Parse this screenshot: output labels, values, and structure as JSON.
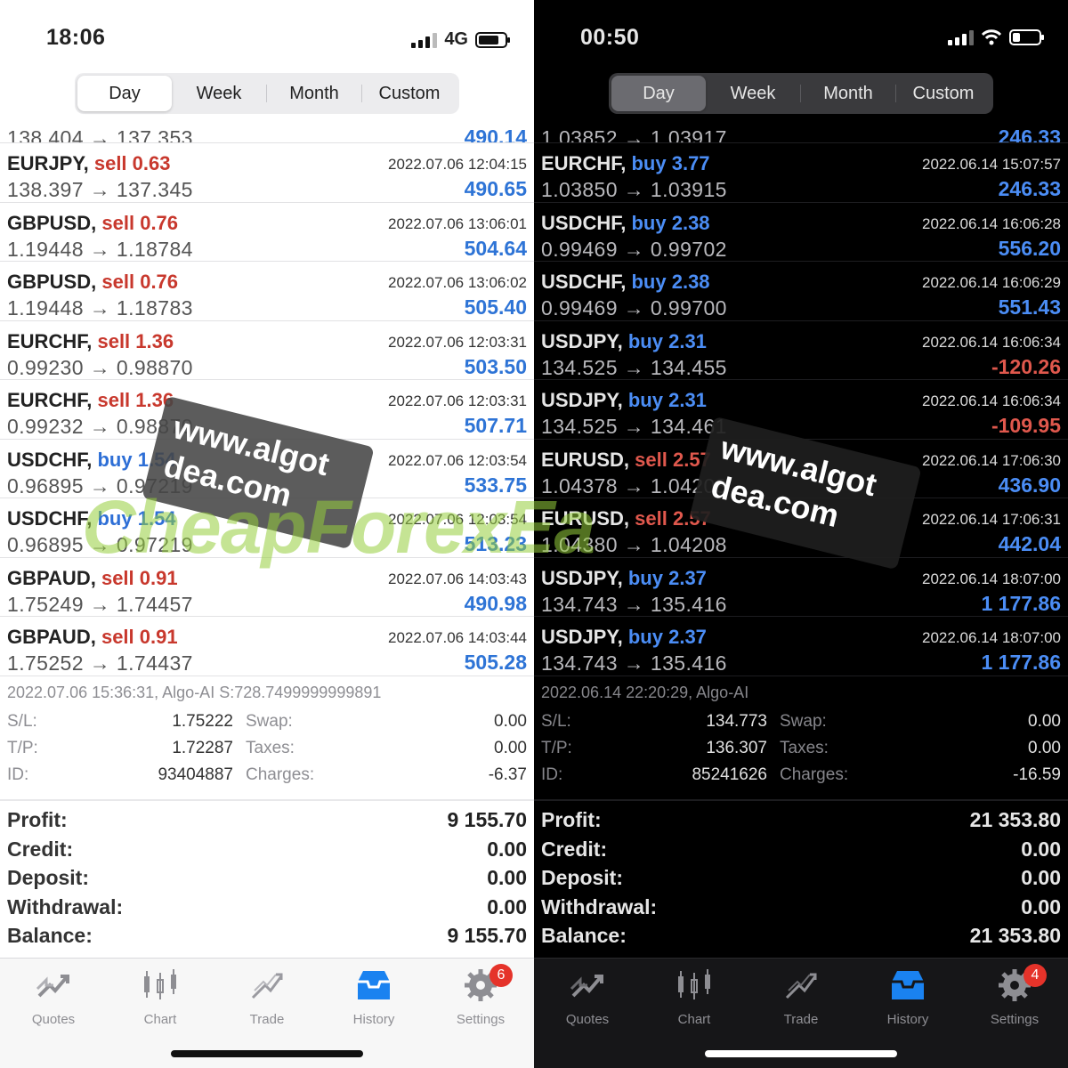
{
  "left": {
    "status": {
      "time": "18:06",
      "network": "4G"
    },
    "tabs": [
      "Day",
      "Week",
      "Month",
      "Custom"
    ],
    "active_tab": "Day",
    "partial_row": {
      "prices": "138.404 → 137.353",
      "pl": "490.14"
    },
    "deals": [
      {
        "symbol": "EURJPY,",
        "side": "sell",
        "volume": "0.63",
        "datetime": "2022.07.06 12:04:15",
        "prices": "138.397 → 137.345",
        "pl": "490.65",
        "neg": false
      },
      {
        "symbol": "GBPUSD,",
        "side": "sell",
        "volume": "0.76",
        "datetime": "2022.07.06 13:06:01",
        "prices": "1.19448 → 1.18784",
        "pl": "504.64",
        "neg": false
      },
      {
        "symbol": "GBPUSD,",
        "side": "sell",
        "volume": "0.76",
        "datetime": "2022.07.06 13:06:02",
        "prices": "1.19448 → 1.18783",
        "pl": "505.40",
        "neg": false
      },
      {
        "symbol": "EURCHF,",
        "side": "sell",
        "volume": "1.36",
        "datetime": "2022.07.06 12:03:31",
        "prices": "0.99230 → 0.98870",
        "pl": "503.50",
        "neg": false
      },
      {
        "symbol": "EURCHF,",
        "side": "sell",
        "volume": "1.36",
        "datetime": "2022.07.06 12:03:31",
        "prices": "0.99232 → 0.98870",
        "pl": "507.71",
        "neg": false
      },
      {
        "symbol": "USDCHF,",
        "side": "buy",
        "volume": "1.54",
        "datetime": "2022.07.06 12:03:54",
        "prices": "0.96895 → 0.97219",
        "pl": "533.75",
        "neg": false
      },
      {
        "symbol": "USDCHF,",
        "side": "buy",
        "volume": "1.54",
        "datetime": "2022.07.06 12:03:54",
        "prices": "0.96895 → 0.97219",
        "pl": "513.23",
        "neg": false
      },
      {
        "symbol": "GBPAUD,",
        "side": "sell",
        "volume": "0.91",
        "datetime": "2022.07.06 14:03:43",
        "prices": "1.75249 → 1.74457",
        "pl": "490.98",
        "neg": false
      },
      {
        "symbol": "GBPAUD,",
        "side": "sell",
        "volume": "0.91",
        "datetime": "2022.07.06 14:03:44",
        "prices": "1.75252 → 1.74437",
        "pl": "505.28",
        "neg": false
      }
    ],
    "detail": {
      "title": "2022.07.06 15:36:31, Algo-AI S:728.7499999999891",
      "sl_label": "S/L:",
      "sl": "1.75222",
      "swap_label": "Swap:",
      "swap": "0.00",
      "tp_label": "T/P:",
      "tp": "1.72287",
      "taxes_label": "Taxes:",
      "taxes": "0.00",
      "id_label": "ID:",
      "id": "93404887",
      "charges_label": "Charges:",
      "charges": "-6.37"
    },
    "summary": {
      "profit_label": "Profit:",
      "profit": "9 155.70",
      "credit_label": "Credit:",
      "credit": "0.00",
      "deposit_label": "Deposit:",
      "deposit": "0.00",
      "withdrawal_label": "Withdrawal:",
      "withdrawal": "0.00",
      "balance_label": "Balance:",
      "balance": "9 155.70"
    },
    "tabbar": [
      "Quotes",
      "Chart",
      "Trade",
      "History",
      "Settings"
    ],
    "settings_badge": "6"
  },
  "right": {
    "status": {
      "time": "00:50"
    },
    "tabs": [
      "Day",
      "Week",
      "Month",
      "Custom"
    ],
    "active_tab": "Day",
    "partial_row": {
      "prices": "1.03852 → 1.03917",
      "pl": "246.33"
    },
    "deals": [
      {
        "symbol": "EURCHF,",
        "side": "buy",
        "volume": "3.77",
        "datetime": "2022.06.14 15:07:57",
        "prices": "1.03850 → 1.03915",
        "pl": "246.33",
        "neg": false
      },
      {
        "symbol": "USDCHF,",
        "side": "buy",
        "volume": "2.38",
        "datetime": "2022.06.14 16:06:28",
        "prices": "0.99469 → 0.99702",
        "pl": "556.20",
        "neg": false
      },
      {
        "symbol": "USDCHF,",
        "side": "buy",
        "volume": "2.38",
        "datetime": "2022.06.14 16:06:29",
        "prices": "0.99469 → 0.99700",
        "pl": "551.43",
        "neg": false
      },
      {
        "symbol": "USDJPY,",
        "side": "buy",
        "volume": "2.31",
        "datetime": "2022.06.14 16:06:34",
        "prices": "134.525 → 134.455",
        "pl": "-120.26",
        "neg": true
      },
      {
        "symbol": "USDJPY,",
        "side": "buy",
        "volume": "2.31",
        "datetime": "2022.06.14 16:06:34",
        "prices": "134.525 → 134.461",
        "pl": "-109.95",
        "neg": true
      },
      {
        "symbol": "EURUSD,",
        "side": "sell",
        "volume": "2.57",
        "datetime": "2022.06.14 17:06:30",
        "prices": "1.04378 → 1.04208",
        "pl": "436.90",
        "neg": false
      },
      {
        "symbol": "EURUSD,",
        "side": "sell",
        "volume": "2.57",
        "datetime": "2022.06.14 17:06:31",
        "prices": "1.04380 → 1.04208",
        "pl": "442.04",
        "neg": false
      },
      {
        "symbol": "USDJPY,",
        "side": "buy",
        "volume": "2.37",
        "datetime": "2022.06.14 18:07:00",
        "prices": "134.743 → 135.416",
        "pl": "1 177.86",
        "neg": false
      },
      {
        "symbol": "USDJPY,",
        "side": "buy",
        "volume": "2.37",
        "datetime": "2022.06.14 18:07:00",
        "prices": "134.743 → 135.416",
        "pl": "1 177.86",
        "neg": false
      }
    ],
    "detail": {
      "title": "2022.06.14 22:20:29, Algo-AI",
      "sl_label": "S/L:",
      "sl": "134.773",
      "swap_label": "Swap:",
      "swap": "0.00",
      "tp_label": "T/P:",
      "tp": "136.307",
      "taxes_label": "Taxes:",
      "taxes": "0.00",
      "id_label": "ID:",
      "id": "85241626",
      "charges_label": "Charges:",
      "charges": "-16.59"
    },
    "summary": {
      "profit_label": "Profit:",
      "profit": "21 353.80",
      "credit_label": "Credit:",
      "credit": "0.00",
      "deposit_label": "Deposit:",
      "deposit": "0.00",
      "withdrawal_label": "Withdrawal:",
      "withdrawal": "0.00",
      "balance_label": "Balance:",
      "balance": "21 353.80"
    },
    "tabbar": [
      "Quotes",
      "Chart",
      "Trade",
      "History",
      "Settings"
    ],
    "settings_badge": "4"
  },
  "watermark": {
    "site_line1": "www.algot",
    "site_line2": "dea.com",
    "brand": "CheapForexEa"
  },
  "colors": {
    "sell": "#c8382d",
    "buy": "#2e6fd6",
    "accent": "#1a82f0",
    "loss": "#e0584d",
    "badge": "#e5332a",
    "watermark_green": "#96cd3c"
  },
  "icons": [
    "quotes-icon",
    "chart-icon",
    "trade-icon",
    "history-icon",
    "settings-icon"
  ]
}
